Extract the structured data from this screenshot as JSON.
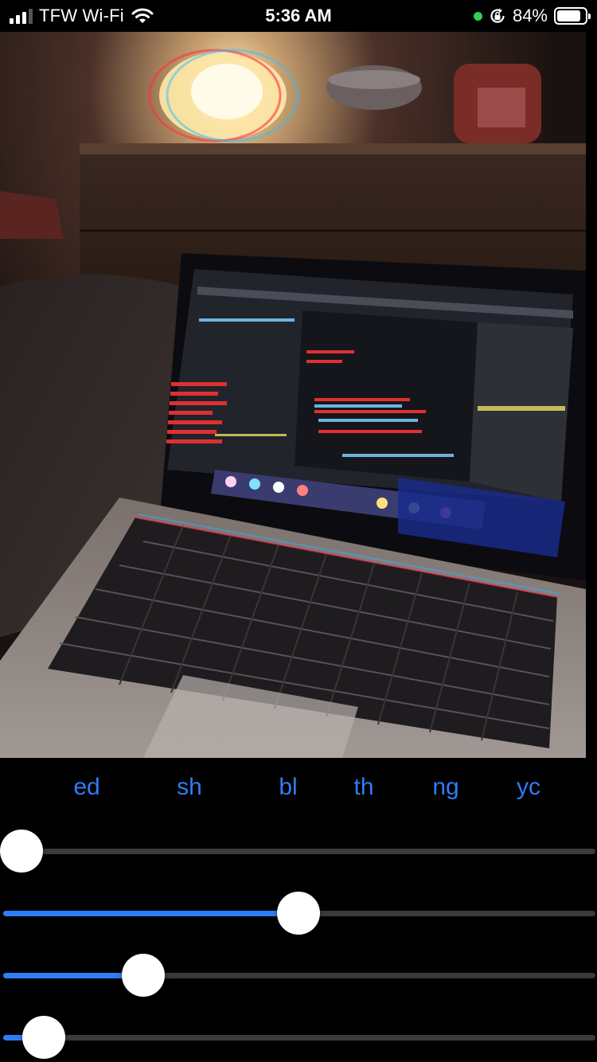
{
  "status_bar": {
    "carrier": "TFW Wi-Fi",
    "time": "5:36 AM",
    "battery_percent": "84%",
    "battery_level": 0.84,
    "signal_bars": 4,
    "signal_active": 3,
    "privacy_indicator_color": "#30d158",
    "icons": [
      "signal-icon",
      "wifi-icon",
      "privacy-dot-icon",
      "rotation-lock-icon",
      "battery-icon"
    ]
  },
  "preview": {
    "description_icon": "photo-preview"
  },
  "filter_tabs": [
    {
      "label": "ed"
    },
    {
      "label": "sh"
    },
    {
      "label": "bl"
    },
    {
      "label": "th"
    },
    {
      "label": "ng"
    },
    {
      "label": "yc"
    }
  ],
  "sliders": [
    {
      "value": 0.0
    },
    {
      "value": 0.5
    },
    {
      "value": 0.22
    },
    {
      "value": 0.04
    }
  ],
  "colors": {
    "accent": "#2f7cf6",
    "track": "#3a3a3c",
    "background": "#000000"
  }
}
